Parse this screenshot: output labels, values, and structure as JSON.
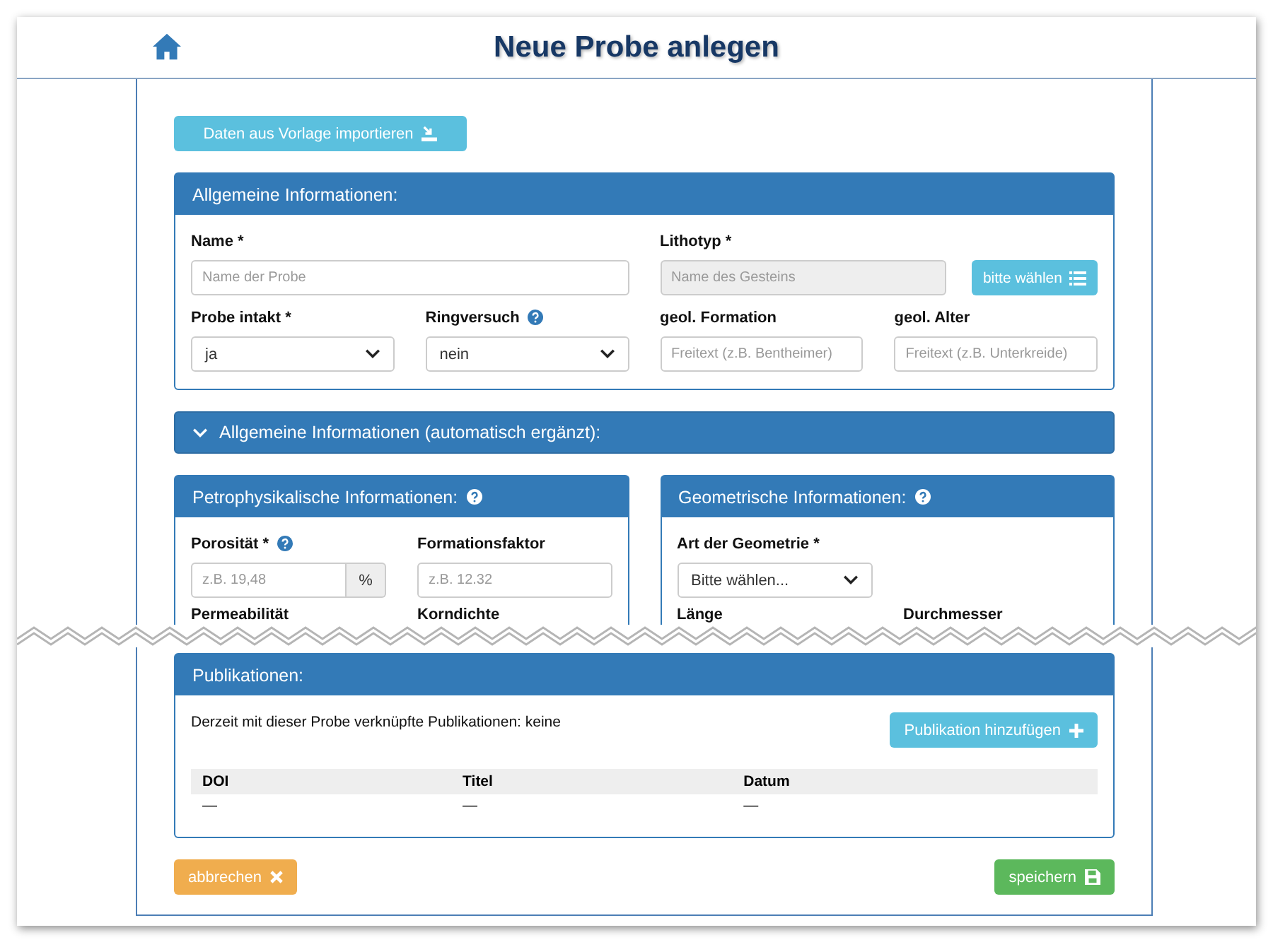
{
  "page": {
    "title": "Neue Probe anlegen"
  },
  "import_button": "Daten aus Vorlage importieren",
  "general": {
    "title": "Allgemeine Informationen:",
    "fields": [
      {
        "kind": "text",
        "label": "Name *",
        "placeholder": "Name der Probe",
        "help": false,
        "disabled": false
      },
      {
        "kind": "picker",
        "label": "Lithotyp *",
        "placeholder": "Name des Gesteins",
        "button": "bitte wählen",
        "help": false,
        "disabled": true
      },
      {
        "kind": "select",
        "label": "Probe intakt *",
        "value": "ja",
        "help": false,
        "disabled": false
      },
      {
        "kind": "select",
        "label": "Ringversuch",
        "value": "nein",
        "help": true,
        "disabled": false
      },
      {
        "kind": "text",
        "label": "geol. Formation",
        "placeholder": "Freitext (z.B. Bentheimer)",
        "help": false,
        "disabled": false
      },
      {
        "kind": "text",
        "label": "geol. Alter",
        "placeholder": "Freitext (z.B. Unterkreide)",
        "help": false,
        "disabled": false
      }
    ]
  },
  "auto_panel": {
    "title": "Allgemeine Informationen (automatisch ergänzt):",
    "expanded": false
  },
  "petro": {
    "title": "Petrophysikalische Informationen:",
    "help": true,
    "fields": [
      {
        "kind": "addon",
        "label": "Porosität *",
        "placeholder": "z.B. 19,48",
        "addon": "%",
        "help": true,
        "disabled": false
      },
      {
        "kind": "text",
        "label": "Formationsfaktor",
        "placeholder": "z.B. 12.32",
        "help": false,
        "disabled": false
      },
      {
        "kind": "label",
        "label": "Permeabilität",
        "help": false,
        "disabled": false
      },
      {
        "kind": "label",
        "label": "Korndichte",
        "help": false,
        "disabled": false
      }
    ]
  },
  "geometry": {
    "title": "Geometrische Informationen:",
    "help": true,
    "fields": [
      {
        "kind": "select",
        "label": "Art der Geometrie *",
        "value": "Bitte wählen...",
        "help": false,
        "disabled": false
      },
      {
        "kind": "empty"
      },
      {
        "kind": "label",
        "label": "Länge",
        "help": false,
        "disabled": false
      },
      {
        "kind": "label",
        "label": "Durchmesser",
        "help": false,
        "disabled": false
      }
    ]
  },
  "publications": {
    "title": "Publikationen:",
    "text": "Derzeit mit dieser Probe verknüpfte Publikationen: keine",
    "add_button": "Publikation hinzufügen",
    "columns": [
      "DOI",
      "Titel",
      "Datum"
    ],
    "rows": [
      [
        "—",
        "—",
        "—"
      ]
    ]
  },
  "actions": {
    "cancel": "abbrechen",
    "save": "speichern"
  }
}
